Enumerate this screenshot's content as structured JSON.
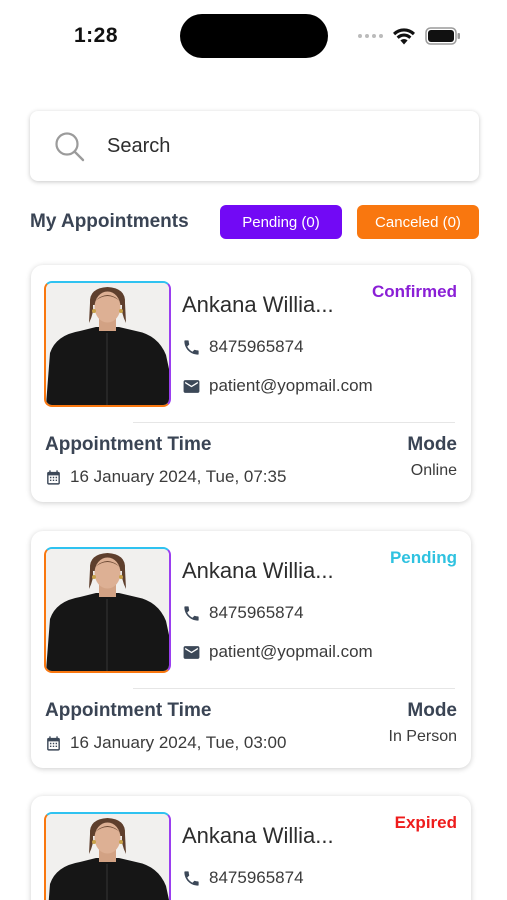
{
  "status_bar": {
    "time": "1:28"
  },
  "search": {
    "label": "Search"
  },
  "appointments_header": {
    "title": "My Appointments",
    "pending_label": "Pending (0)",
    "canceled_label": "Canceled (0)",
    "pending_color": "#7209f5",
    "canceled_color": "#f9770f"
  },
  "cards": [
    {
      "name": "Ankana Willia...",
      "status": "Confirmed",
      "status_color": "#8a1fd6",
      "phone": "8475965874",
      "email": "patient@yopmail.com",
      "appointment_label": "Appointment Time",
      "datetime": "16 January 2024, Tue, 07:35",
      "mode_label": "Mode",
      "mode": "Online"
    },
    {
      "name": "Ankana Willia...",
      "status": "Pending",
      "status_color": "#2fc2e0",
      "phone": "8475965874",
      "email": "patient@yopmail.com",
      "appointment_label": "Appointment Time",
      "datetime": "16 January 2024, Tue, 03:00",
      "mode_label": "Mode",
      "mode": "In Person"
    },
    {
      "name": "Ankana Willia...",
      "status": "Expired",
      "status_color": "#ee1c1c",
      "phone": "8475965874"
    }
  ]
}
